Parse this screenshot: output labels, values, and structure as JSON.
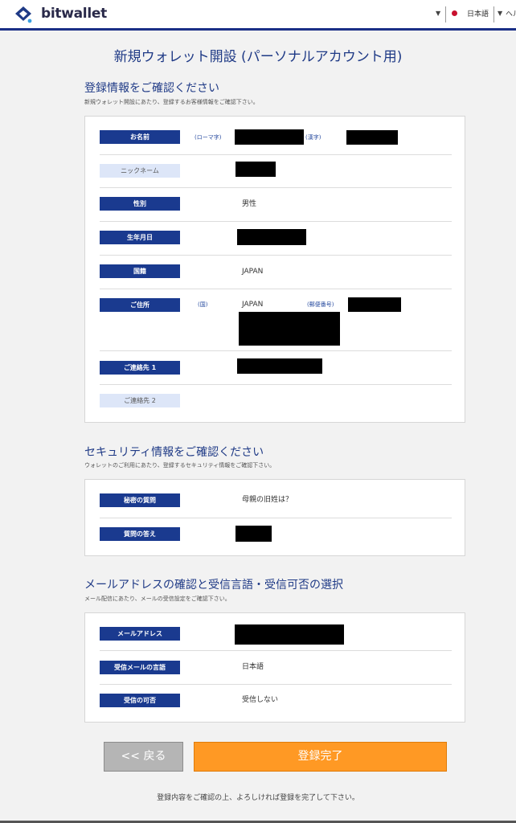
{
  "header": {
    "logo_text": "bitwallet",
    "caret": "▼",
    "language": "日本語",
    "help_text": "ヘル",
    "colors": {
      "brand": "#1a2f86",
      "flag": "#c8102e"
    }
  },
  "page_title": "新規ウォレット開設 (パーソナルアカウント用)",
  "registration": {
    "title": "登録情報をご確認ください",
    "subtitle": "新規ウォレット開設にあたり、登録するお客様情報をご確認下さい。",
    "name_label": "お名前",
    "name_romaji_hint": "(ローマ字)",
    "name_kanji_hint": "(漢字)",
    "nickname_label": "ニックネーム",
    "gender_label": "性別",
    "gender_value": "男性",
    "birthdate_label": "生年月日",
    "nationality_label": "国籍",
    "nationality_value": "JAPAN",
    "address_label": "ご住所",
    "address_country_hint": "(国)",
    "address_country_value": "JAPAN",
    "address_postal_hint": "(郵便番号)",
    "contact1_label": "ご連絡先 1",
    "contact2_label": "ご連絡先 2"
  },
  "security": {
    "title": "セキュリティ情報をご確認ください",
    "subtitle": "ウォレットのご利用にあたり、登録するセキュリティ情報をご確認下さい。",
    "question_label": "秘密の質問",
    "question_value": "母親の旧姓は？",
    "answer_label": "質問の答え"
  },
  "email": {
    "title": "メールアドレスの確認と受信言語・受信可否の選択",
    "subtitle": "メール配信にあたり、メールの受信設定をご確認下さい。",
    "address_label": "メールアドレス",
    "language_label": "受信メールの言語",
    "language_value": "日本語",
    "receive_label": "受信の可否",
    "receive_value": "受信しない"
  },
  "buttons": {
    "back": "<< 戻る",
    "complete": "登録完了"
  },
  "footer_note": "登録内容をご確認の上、よろしければ登録を完了して下さい。",
  "colors": {
    "label_bg": "#1a3a8f",
    "label_optional_bg": "#dde6f8",
    "accent_orange": "#ff9924",
    "title_blue": "#1f3a86"
  }
}
